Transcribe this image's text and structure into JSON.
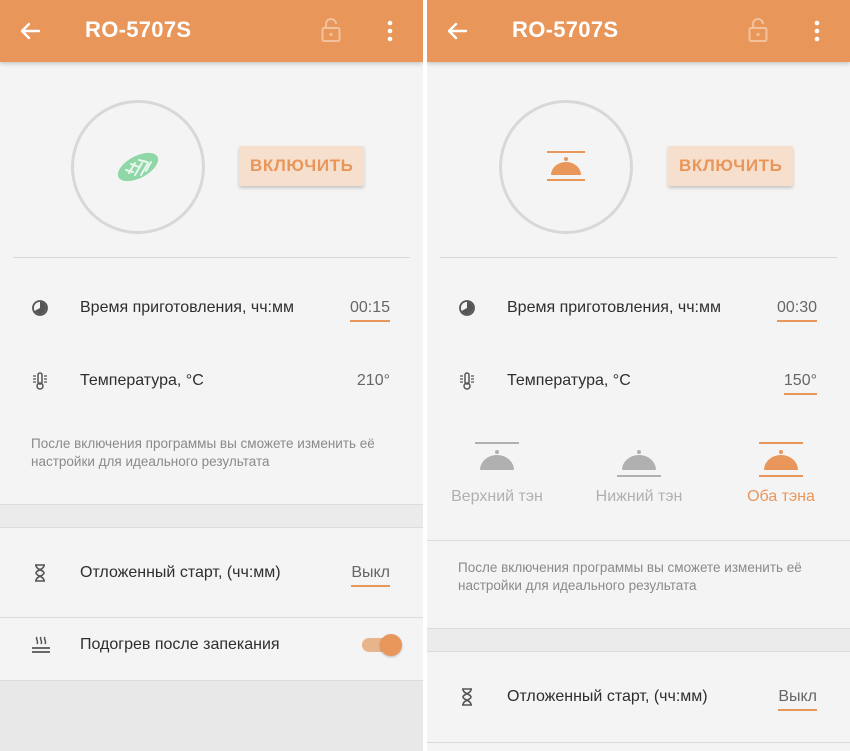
{
  "colors": {
    "accent": "#e9965a",
    "appbar": "#e9965a",
    "bread_icon": "#8fd7a6",
    "button_bg": "#f7dfcd",
    "inactive": "#b0b0b0"
  },
  "left": {
    "title": "RO-5707S",
    "mode_icon": "bread-icon",
    "on_button": "ВКЛЮЧИТЬ",
    "cook_time": {
      "label": "Время приготовления, чч:мм",
      "value": "00:15"
    },
    "temperature": {
      "label": "Температура, °C",
      "value": "210°"
    },
    "hint": "После включения программы вы сможете изменить её настройки для идеального результата",
    "delayed_start": {
      "label": "Отложенный старт, (чч:мм)",
      "value": "Выкл"
    },
    "keep_warm": {
      "label": "Подогрев после запекания",
      "enabled": true
    }
  },
  "right": {
    "title": "RO-5707S",
    "mode_icon": "both-heaters-icon",
    "on_button": "ВКЛЮЧИТЬ",
    "cook_time": {
      "label": "Время приготовления, чч:мм",
      "value": "00:30"
    },
    "temperature": {
      "label": "Температура, °C",
      "value": "150°"
    },
    "heating": {
      "options": [
        {
          "label": "Верхний тэн",
          "icon": "top-heater-icon",
          "selected": false
        },
        {
          "label": "Нижний тэн",
          "icon": "bottom-heater-icon",
          "selected": false
        },
        {
          "label": "Оба тэна",
          "icon": "both-heaters-icon",
          "selected": true
        }
      ]
    },
    "hint": "После включения программы вы сможете изменить её настройки для идеального результата",
    "delayed_start": {
      "label": "Отложенный старт, (чч:мм)",
      "value": "Выкл"
    }
  }
}
